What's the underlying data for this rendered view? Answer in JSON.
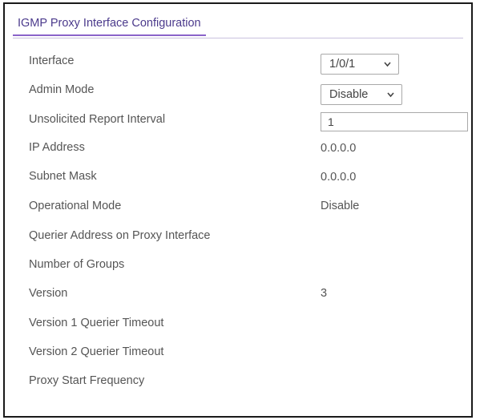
{
  "panel": {
    "title": "IGMP Proxy Interface Configuration"
  },
  "fields": {
    "interface": {
      "label": "Interface",
      "selected": "1/0/1"
    },
    "admin_mode": {
      "label": "Admin Mode",
      "selected": "Disable"
    },
    "unsolicited_report_interval": {
      "label": "Unsolicited Report Interval",
      "value": "1"
    },
    "ip_address": {
      "label": "IP Address",
      "value": "0.0.0.0"
    },
    "subnet_mask": {
      "label": "Subnet Mask",
      "value": "0.0.0.0"
    },
    "operational_mode": {
      "label": "Operational Mode",
      "value": "Disable"
    },
    "querier_address": {
      "label": "Querier Address on Proxy Interface",
      "value": ""
    },
    "number_of_groups": {
      "label": "Number of Groups",
      "value": ""
    },
    "version": {
      "label": "Version",
      "value": "3"
    },
    "v1_querier_timeout": {
      "label": "Version 1 Querier Timeout",
      "value": ""
    },
    "v2_querier_timeout": {
      "label": "Version 2 Querier Timeout",
      "value": ""
    },
    "proxy_start_frequency": {
      "label": "Proxy Start Frequency",
      "value": ""
    }
  },
  "icons": {
    "dropdown": "chevron-down-icon"
  },
  "colors": {
    "title_text": "#4b3a8c",
    "title_underline": "#8a63c9",
    "label_text": "#555555"
  }
}
